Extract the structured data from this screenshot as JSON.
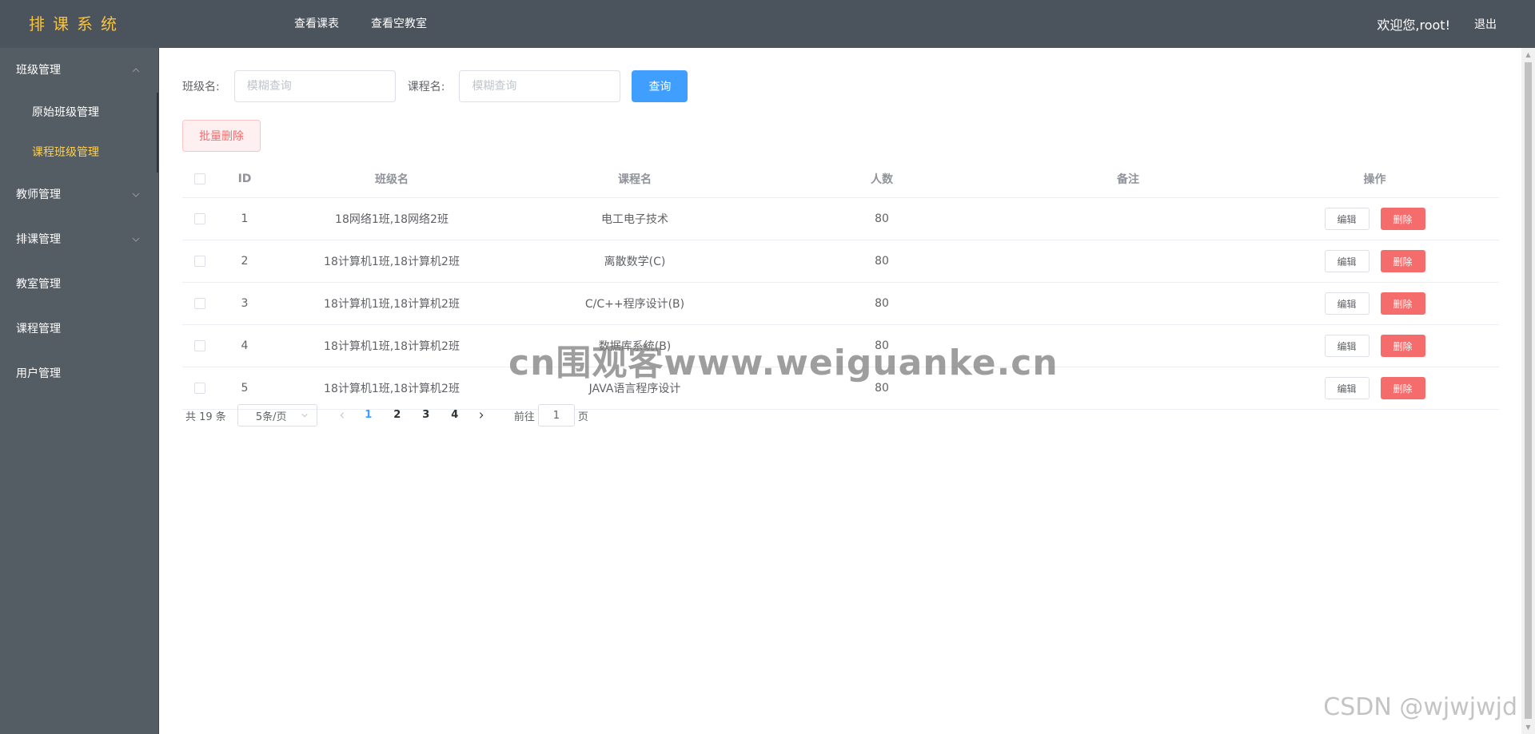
{
  "app": {
    "title": "排课系统"
  },
  "topnav": {
    "items": [
      "查看课表",
      "查看空教室"
    ]
  },
  "user": {
    "welcome": "欢迎您,root!",
    "logout": "退出"
  },
  "sidebar": {
    "groups": [
      {
        "label": "班级管理",
        "expanded": true,
        "children": [
          {
            "label": "原始班级管理",
            "active": false
          },
          {
            "label": "课程班级管理",
            "active": true
          }
        ]
      },
      {
        "label": "教师管理",
        "expanded": false
      },
      {
        "label": "排课管理",
        "expanded": false
      },
      {
        "label": "教室管理"
      },
      {
        "label": "课程管理"
      },
      {
        "label": "用户管理"
      }
    ]
  },
  "search": {
    "class_label": "班级名:",
    "class_placeholder": "模糊查询",
    "course_label": "课程名:",
    "course_placeholder": "模糊查询",
    "query_button": "查询"
  },
  "batch_delete": "批量删除",
  "table": {
    "headers": {
      "id": "ID",
      "class_name": "班级名",
      "course_name": "课程名",
      "count": "人数",
      "remark": "备注",
      "ops": "操作"
    },
    "rows": [
      {
        "id": "1",
        "class_name": "18网络1班,18网络2班",
        "course_name": "电工电子技术",
        "count": "80",
        "remark": ""
      },
      {
        "id": "2",
        "class_name": "18计算机1班,18计算机2班",
        "course_name": "离散数学(C)",
        "count": "80",
        "remark": ""
      },
      {
        "id": "3",
        "class_name": "18计算机1班,18计算机2班",
        "course_name": "C/C++程序设计(B)",
        "count": "80",
        "remark": ""
      },
      {
        "id": "4",
        "class_name": "18计算机1班,18计算机2班",
        "course_name": "数据库系统(B)",
        "count": "80",
        "remark": ""
      },
      {
        "id": "5",
        "class_name": "18计算机1班,18计算机2班",
        "course_name": "JAVA语言程序设计",
        "count": "80",
        "remark": ""
      }
    ],
    "edit_label": "编辑",
    "delete_label": "删除"
  },
  "pagination": {
    "total": "共 19 条",
    "page_size": "5条/页",
    "pages": [
      "1",
      "2",
      "3",
      "4"
    ],
    "current_page": "1",
    "goto_prefix": "前往",
    "goto_value": "1",
    "goto_suffix": "页"
  },
  "watermarks": {
    "center": "cn围观客www.weiguanke.cn",
    "corner": "CSDN @wjwjwjd"
  },
  "colors": {
    "header_bg": "#4b535c",
    "sidebar_bg": "#545c64",
    "brand": "#f5c242",
    "active_menu": "#ffd04b",
    "primary": "#409eff",
    "danger": "#f56c6c"
  }
}
